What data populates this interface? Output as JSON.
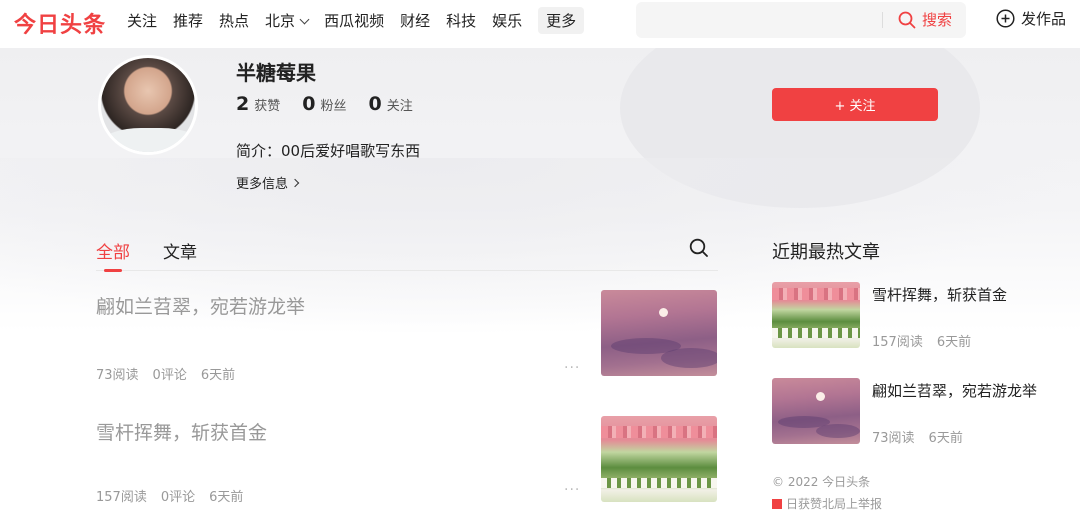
{
  "header": {
    "logo": "今日头条",
    "nav": [
      "关注",
      "推荐",
      "热点",
      "北京",
      "西瓜视频",
      "财经",
      "科技",
      "娱乐"
    ],
    "more_label": "更多",
    "search_label": "搜索",
    "publish_label": "发作品"
  },
  "profile": {
    "name": "半糖莓果",
    "stats": [
      {
        "num": "2",
        "label": "获赞"
      },
      {
        "num": "0",
        "label": "粉丝"
      },
      {
        "num": "0",
        "label": "关注"
      }
    ],
    "bio": "简介：00后爱好唱歌写东西",
    "more_info": "更多信息",
    "follow_label": "+ 关注"
  },
  "tabs": [
    "全部",
    "文章"
  ],
  "articles": [
    {
      "title": "翩如兰苕翠，宛若游龙举",
      "reads": "73阅读",
      "comments": "0评论",
      "time": "6天前",
      "thumb": "sunset"
    },
    {
      "title": "雪杆挥舞，斩获首金",
      "reads": "157阅读",
      "comments": "0评论",
      "time": "6天前",
      "thumb": "tulip"
    }
  ],
  "sidebar": {
    "title": "近期最热文章",
    "hot": [
      {
        "title": "雪杆挥舞，斩获首金",
        "reads": "157阅读",
        "time": "6天前",
        "thumb": "tulip"
      },
      {
        "title": "翩如兰苕翠，宛若游龙举",
        "reads": "73阅读",
        "time": "6天前",
        "thumb": "sunset"
      }
    ],
    "copyright": "© 2022 今日头条",
    "report": "日获赞北局上举报"
  },
  "colors": {
    "brand": "#f04142",
    "muted": "#999999"
  },
  "icons": [
    "search-icon",
    "plus-circle-icon",
    "chevron-down-icon",
    "chevron-right-icon",
    "more-dots-icon"
  ]
}
